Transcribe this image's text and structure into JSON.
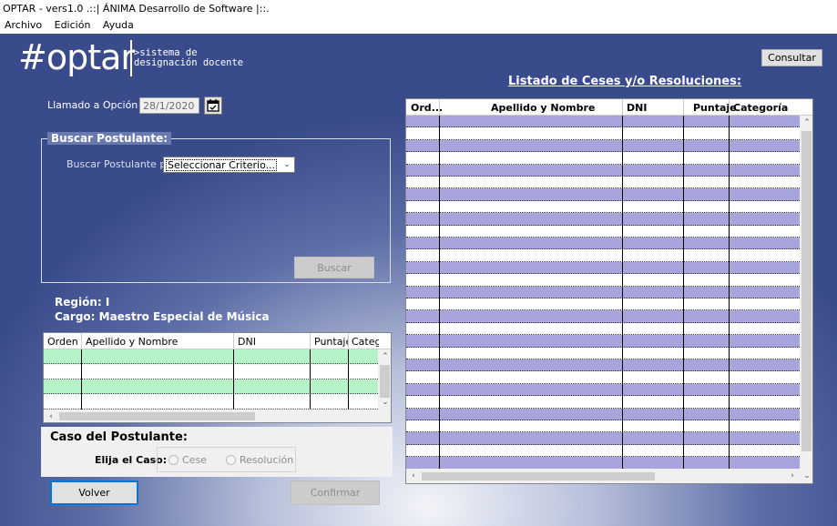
{
  "window": {
    "title": "OPTAR - vers1.0 .::| ÁNIMA Desarrollo de Software |::."
  },
  "menu": [
    "Archivo",
    "Edición",
    "Ayuda"
  ],
  "logo": {
    "hash": "#optar",
    "subtitle": ">sistema de\ndesignación docente"
  },
  "consultar_label": "Consultar",
  "llamado": {
    "label": "Llamado a Opción del:",
    "value": "28/1/2020"
  },
  "buscar": {
    "title": "Buscar Postulante:",
    "por_label": "Buscar Postulante por:",
    "criterio_value": "Seleccionar Criterio...",
    "button_label": "Buscar"
  },
  "region": "Región: I",
  "cargo": "Cargo: Maestro Especial de Música",
  "left_grid": {
    "columns": [
      "Orden",
      "Apellido y Nombre",
      "DNI",
      "Puntaje",
      "Categoría"
    ],
    "row_colors": [
      "#b4f2c7",
      "#ffffff",
      "#b4f2c7",
      "#ffffff"
    ]
  },
  "caso": {
    "title": "Caso del Postulante:",
    "elija_label": "Elija el Caso:",
    "options": [
      "Cese",
      "Resolución"
    ]
  },
  "volver_label": "Volver",
  "confirmar_label": "Confirmar",
  "listado": {
    "title": "Listado de Ceses y/o Resoluciones:",
    "columns": [
      "Ord...",
      "Apellido y Nombre",
      "DNI",
      "Puntaje",
      "Categoría"
    ],
    "row_colors": [
      "#a8a4dc",
      "#ffffff"
    ],
    "row_count": 29
  },
  "colors": {
    "accent_row_blue": "#a8a4dc",
    "accent_row_green": "#b4f2c7",
    "background_blue": "#3a4b8c"
  }
}
